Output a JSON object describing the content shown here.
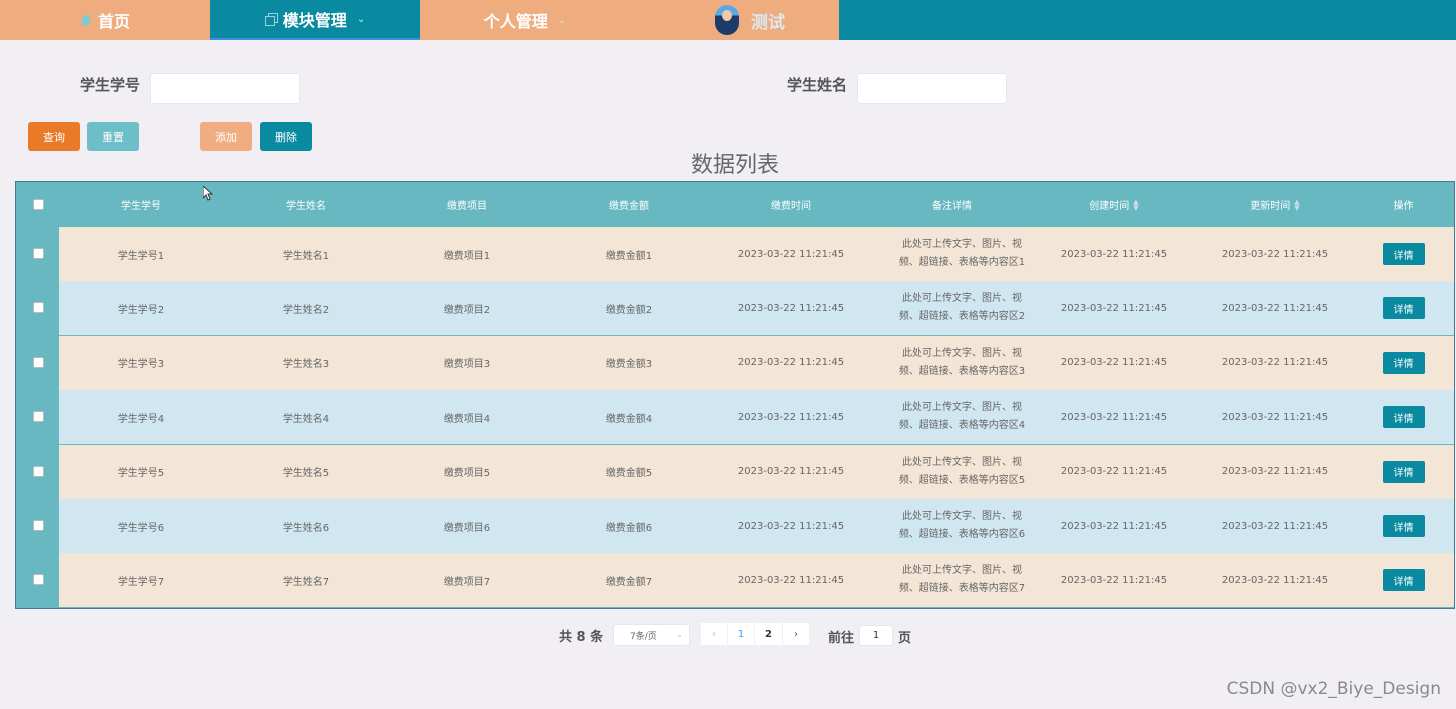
{
  "nav": {
    "home": "首页",
    "module": "模块管理",
    "personal": "个人管理",
    "username": "测试"
  },
  "search": {
    "student_id_label": "学生学号",
    "student_id_value": "",
    "student_name_label": "学生姓名",
    "student_name_value": ""
  },
  "actions": {
    "search": "查询",
    "reset": "重置",
    "add": "添加",
    "delete": "删除"
  },
  "list_title": "数据列表",
  "table": {
    "columns": [
      "学生学号",
      "学生姓名",
      "缴费项目",
      "缴费金额",
      "缴费时间",
      "备注详情",
      "创建时间",
      "更新时间",
      "操作"
    ],
    "rows": [
      {
        "sid": "学生学号1",
        "name": "学生姓名1",
        "item": "缴费项目1",
        "amount": "缴费金额1",
        "paytime": "2023-03-22 11:21:45",
        "desc1": "此处可上传文字、图片、视",
        "desc2": "频、超链接、表格等内容区1",
        "created": "2023-03-22 11:21:45",
        "updated": "2023-03-22 11:21:45",
        "action": "详情"
      },
      {
        "sid": "学生学号2",
        "name": "学生姓名2",
        "item": "缴费项目2",
        "amount": "缴费金额2",
        "paytime": "2023-03-22 11:21:45",
        "desc1": "此处可上传文字、图片、视",
        "desc2": "频、超链接、表格等内容区2",
        "created": "2023-03-22 11:21:45",
        "updated": "2023-03-22 11:21:45",
        "action": "详情"
      },
      {
        "sid": "学生学号3",
        "name": "学生姓名3",
        "item": "缴费项目3",
        "amount": "缴费金额3",
        "paytime": "2023-03-22 11:21:45",
        "desc1": "此处可上传文字、图片、视",
        "desc2": "频、超链接、表格等内容区3",
        "created": "2023-03-22 11:21:45",
        "updated": "2023-03-22 11:21:45",
        "action": "详情"
      },
      {
        "sid": "学生学号4",
        "name": "学生姓名4",
        "item": "缴费项目4",
        "amount": "缴费金额4",
        "paytime": "2023-03-22 11:21:45",
        "desc1": "此处可上传文字、图片、视",
        "desc2": "频、超链接、表格等内容区4",
        "created": "2023-03-22 11:21:45",
        "updated": "2023-03-22 11:21:45",
        "action": "详情"
      },
      {
        "sid": "学生学号5",
        "name": "学生姓名5",
        "item": "缴费项目5",
        "amount": "缴费金额5",
        "paytime": "2023-03-22 11:21:45",
        "desc1": "此处可上传文字、图片、视",
        "desc2": "频、超链接、表格等内容区5",
        "created": "2023-03-22 11:21:45",
        "updated": "2023-03-22 11:21:45",
        "action": "详情"
      },
      {
        "sid": "学生学号6",
        "name": "学生姓名6",
        "item": "缴费项目6",
        "amount": "缴费金额6",
        "paytime": "2023-03-22 11:21:45",
        "desc1": "此处可上传文字、图片、视",
        "desc2": "频、超链接、表格等内容区6",
        "created": "2023-03-22 11:21:45",
        "updated": "2023-03-22 11:21:45",
        "action": "详情"
      },
      {
        "sid": "学生学号7",
        "name": "学生姓名7",
        "item": "缴费项目7",
        "amount": "缴费金额7",
        "paytime": "2023-03-22 11:21:45",
        "desc1": "此处可上传文字、图片、视",
        "desc2": "频、超链接、表格等内容区7",
        "created": "2023-03-22 11:21:45",
        "updated": "2023-03-22 11:21:45",
        "action": "详情"
      }
    ]
  },
  "pagination": {
    "total": "共 8 条",
    "page_size": "7条/页",
    "prev": "‹",
    "pages": [
      "1",
      "2"
    ],
    "next": "›",
    "goto_label": "前往",
    "goto_value": "1",
    "goto_suffix": "页"
  },
  "watermark": "CSDN @vx2_Biye_Design",
  "colors": {
    "nav_orange": "#efac7f",
    "nav_teal": "#0a8aa0",
    "header_teal": "#67b8c1",
    "row_beige": "#f3e6d6",
    "row_blue": "#d0e7f2",
    "search_btn": "#e97a28"
  },
  "icons": {
    "home": "home-icon",
    "module": "copy-icon",
    "sort": "sort-icon",
    "dropdown": "chevron-down-icon"
  }
}
